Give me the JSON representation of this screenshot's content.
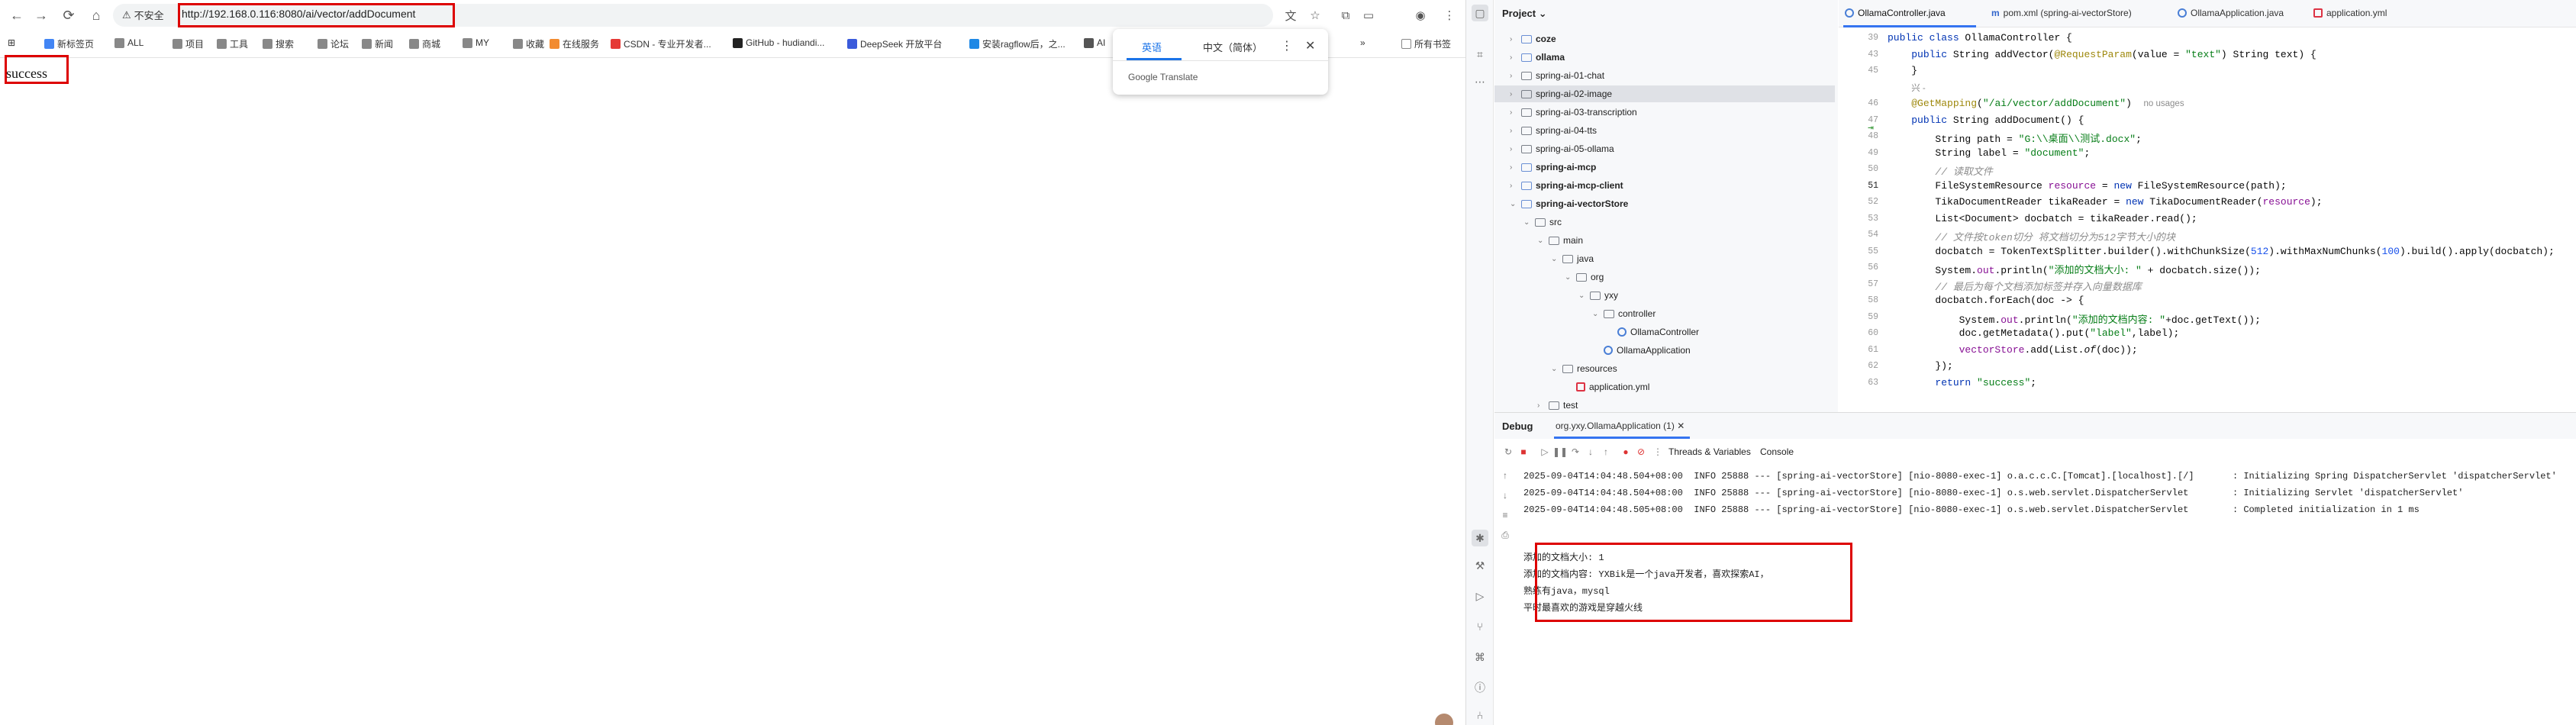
{
  "browser": {
    "insecure_label": "不安全",
    "url": "http://192.168.0.116:8080/ai/vector/addDocument",
    "bookmarks": [
      {
        "label": "新标签页",
        "color": "#4285f4"
      },
      {
        "label": "ALL",
        "color": "#888888"
      },
      {
        "label": "项目",
        "color": "#888888"
      },
      {
        "label": "工具",
        "color": "#888888"
      },
      {
        "label": "搜索",
        "color": "#888888"
      },
      {
        "label": "论坛",
        "color": "#888888"
      },
      {
        "label": "新闻",
        "color": "#888888"
      },
      {
        "label": "商城",
        "color": "#888888"
      },
      {
        "label": "MY",
        "color": "#888888"
      },
      {
        "label": "收藏",
        "color": "#888888"
      },
      {
        "label": "在线服务",
        "color": "#f28b30"
      },
      {
        "label": "CSDN - 专业开发者...",
        "color": "#e53935"
      },
      {
        "label": "GitHub - hudiandi...",
        "color": "#222222"
      },
      {
        "label": "DeepSeek 开放平台",
        "color": "#3b5bdb"
      },
      {
        "label": "安装ragflow后，之...",
        "color": "#1e88e5"
      },
      {
        "label": "AI",
        "color": "#555555"
      }
    ],
    "bookmarks_overflow": "»",
    "all_bookmarks": "所有书签",
    "page_text": "success",
    "translate": {
      "tab_english": "英语",
      "tab_chinese": "中文（简体）",
      "brand": "Google Translate",
      "more": "⋮",
      "close": "✕"
    }
  },
  "ide": {
    "project_title": "Project",
    "tree": [
      {
        "label": "coze",
        "depth": 0,
        "chev": "›",
        "type": "folder",
        "bold": true,
        "selected": false
      },
      {
        "label": "ollama",
        "depth": 0,
        "chev": "›",
        "type": "folder",
        "bold": true,
        "selected": false
      },
      {
        "label": "spring-ai-01-chat",
        "depth": 0,
        "chev": "›",
        "type": "folder",
        "bold": false,
        "selected": false
      },
      {
        "label": "spring-ai-02-image",
        "depth": 0,
        "chev": "›",
        "type": "folder",
        "bold": false,
        "selected": true
      },
      {
        "label": "spring-ai-03-transcription",
        "depth": 0,
        "chev": "›",
        "type": "folder",
        "bold": false,
        "selected": false
      },
      {
        "label": "spring-ai-04-tts",
        "depth": 0,
        "chev": "›",
        "type": "folder",
        "bold": false,
        "selected": false
      },
      {
        "label": "spring-ai-05-ollama",
        "depth": 0,
        "chev": "›",
        "type": "folder",
        "bold": false,
        "selected": false
      },
      {
        "label": "spring-ai-mcp",
        "depth": 0,
        "chev": "›",
        "type": "folder",
        "bold": true,
        "selected": false
      },
      {
        "label": "spring-ai-mcp-client",
        "depth": 0,
        "chev": "›",
        "type": "folder",
        "bold": true,
        "selected": false
      },
      {
        "label": "spring-ai-vectorStore",
        "depth": 0,
        "chev": "⌄",
        "type": "folder",
        "bold": true,
        "selected": false
      },
      {
        "label": "src",
        "depth": 1,
        "chev": "⌄",
        "type": "folder",
        "bold": false,
        "selected": false
      },
      {
        "label": "main",
        "depth": 2,
        "chev": "⌄",
        "type": "folder",
        "bold": false,
        "selected": false
      },
      {
        "label": "java",
        "depth": 3,
        "chev": "⌄",
        "type": "folder",
        "bold": false,
        "selected": false
      },
      {
        "label": "org",
        "depth": 4,
        "chev": "⌄",
        "type": "folder",
        "bold": false,
        "selected": false
      },
      {
        "label": "yxy",
        "depth": 5,
        "chev": "⌄",
        "type": "folder",
        "bold": false,
        "selected": false
      },
      {
        "label": "controller",
        "depth": 6,
        "chev": "⌄",
        "type": "folder",
        "bold": false,
        "selected": false
      },
      {
        "label": "OllamaController",
        "depth": 7,
        "chev": "",
        "type": "class",
        "bold": false,
        "selected": false
      },
      {
        "label": "OllamaApplication",
        "depth": 6,
        "chev": "",
        "type": "class",
        "bold": false,
        "selected": false
      },
      {
        "label": "resources",
        "depth": 3,
        "chev": "⌄",
        "type": "folder",
        "bold": false,
        "selected": false
      },
      {
        "label": "application.yml",
        "depth": 4,
        "chev": "",
        "type": "yml",
        "bold": false,
        "selected": false
      },
      {
        "label": "test",
        "depth": 2,
        "chev": "›",
        "type": "folder",
        "bold": false,
        "selected": false
      }
    ],
    "tabs": [
      {
        "label": "OllamaController.java",
        "icon": "class"
      },
      {
        "label": "pom.xml (spring-ai-vectorStore)",
        "icon": "maven"
      },
      {
        "label": "OllamaApplication.java",
        "icon": "class"
      },
      {
        "label": "application.yml",
        "icon": "yml"
      }
    ],
    "code_lines": [
      {
        "n": "39",
        "html": "<span class=\"kw\">public class</span> OllamaController {"
      },
      {
        "n": "43",
        "html": "    <span class=\"kw\">public</span> String addVector(<span class=\"ann\">@RequestParam</span>(value = <span class=\"str\">\"text\"</span>) String text) {"
      },
      {
        "n": "45",
        "html": "    }"
      },
      {
        "n": "",
        "html": "    <span class=\"hint\">兴 -</span>"
      },
      {
        "n": "46",
        "html": "    <span class=\"ann\">@GetMapping</span>(<span class=\"str\">\"/ai/vector/addDocument\"</span>)  <span class=\"hint\">no usages</span>"
      },
      {
        "n": "47",
        "html": "    <span class=\"kw\">public</span> String addDocument() {"
      },
      {
        "n": "48",
        "html": "        String path = <span class=\"str\">\"G:\\\\桌面\\\\测试.docx\"</span>;"
      },
      {
        "n": "49",
        "html": "        String label = <span class=\"str\">\"document\"</span>;"
      },
      {
        "n": "50",
        "html": "        <span class=\"cmt\">// 读取文件</span>"
      },
      {
        "n": "51",
        "html": "        FileSystemResource <span class=\"fld\">resource</span> = <span class=\"kw\">new</span> FileSystemResource(path);"
      },
      {
        "n": "52",
        "html": "        TikaDocumentReader tikaReader = <span class=\"kw\">new</span> TikaDocumentReader(<span class=\"fld\">resource</span>);"
      },
      {
        "n": "53",
        "html": "        List&lt;Document&gt; docbatch = tikaReader.read();"
      },
      {
        "n": "54",
        "html": "        <span class=\"cmt\">// 文件按token切分 将文档切分为512字节大小的块</span>"
      },
      {
        "n": "55",
        "html": "        docbatch = TokenTextSplitter.builder().withChunkSize(<span class=\"num\">512</span>).withMaxNumChunks(<span class=\"num\">100</span>).build().apply(docbatch);"
      },
      {
        "n": "56",
        "html": "        System.<span class=\"fld\">out</span>.println(<span class=\"str\">\"添加的文档大小: \"</span> + docbatch.size());"
      },
      {
        "n": "57",
        "html": "        <span class=\"cmt\">// 最后为每个文档添加标签并存入向量数据库</span>"
      },
      {
        "n": "58",
        "html": "        docbatch.forEach(doc -&gt; {"
      },
      {
        "n": "59",
        "html": "            System.<span class=\"fld\">out</span>.println(<span class=\"str\">\"添加的文档内容: \"</span>+doc.getText());"
      },
      {
        "n": "60",
        "html": "            doc.getMetadata().put(<span class=\"str\">\"label\"</span>,label);"
      },
      {
        "n": "61",
        "html": "            <span class=\"fld\">vectorStore</span>.add(List.<i>of</i>(doc));"
      },
      {
        "n": "62",
        "html": "        });"
      },
      {
        "n": "63",
        "html": "        <span class=\"kw\">return</span> <span class=\"str\">\"success\"</span>;"
      }
    ],
    "debug": {
      "title": "Debug",
      "session_tab": "org.yxy.OllamaApplication (1)",
      "threads_tab": "Threads & Variables",
      "console_tab": "Console",
      "log_lines": [
        "2025-09-04T14:04:48.504+08:00  INFO 25888 --- [spring-ai-vectorStore] [nio-8080-exec-1] o.a.c.c.C.[Tomcat].[localhost].[/]       : Initializing Spring DispatcherServlet 'dispatcherServlet'",
        "2025-09-04T14:04:48.504+08:00  INFO 25888 --- [spring-ai-vectorStore] [nio-8080-exec-1] o.s.web.servlet.DispatcherServlet        : Initializing Servlet 'dispatcherServlet'",
        "2025-09-04T14:04:48.505+08:00  INFO 25888 --- [spring-ai-vectorStore] [nio-8080-exec-1] o.s.web.servlet.DispatcherServlet        : Completed initialization in 1 ms"
      ],
      "output_lines": [
        "添加的文档大小: 1",
        "添加的文档内容: YXBik是一个java开发者，喜欢探索AI，",
        "熟练有java，mysql",
        "平时最喜欢的游戏是穿越火线"
      ]
    }
  }
}
